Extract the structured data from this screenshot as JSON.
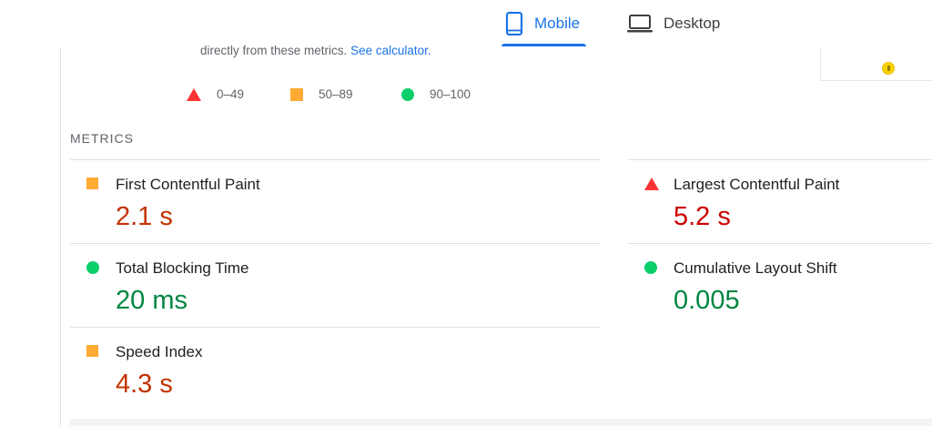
{
  "device_tabs": {
    "mobile": {
      "label": "Mobile",
      "active": true,
      "icon": "smartphone-icon"
    },
    "desktop": {
      "label": "Desktop",
      "active": false,
      "icon": "laptop-icon"
    }
  },
  "calculator_note": {
    "text": "directly from these metrics.",
    "link_label": "See calculator."
  },
  "legend": {
    "fail": {
      "range": "0–49",
      "icon": "red-triangle-icon",
      "color": "#ff3333"
    },
    "average": {
      "range": "50–89",
      "icon": "orange-square-icon",
      "color": "#ffaa33"
    },
    "pass": {
      "range": "90–100",
      "icon": "green-circle-icon",
      "color": "#0cce6b"
    }
  },
  "metrics": {
    "header": "METRICS",
    "fcp": {
      "name": "First Contentful Paint",
      "value": "2.1 s",
      "rating": "average"
    },
    "lcp": {
      "name": "Largest Contentful Paint",
      "value": "5.2 s",
      "rating": "fail"
    },
    "tbt": {
      "name": "Total Blocking Time",
      "value": "20 ms",
      "rating": "pass"
    },
    "cls": {
      "name": "Cumulative Layout Shift",
      "value": "0.005",
      "rating": "pass"
    },
    "si": {
      "name": "Speed Index",
      "value": "4.3 s",
      "rating": "average"
    }
  },
  "colors": {
    "accent": "#1a73e8",
    "fail_text": "#cc0000",
    "average_text": "#c33300",
    "pass_text": "#018642"
  }
}
